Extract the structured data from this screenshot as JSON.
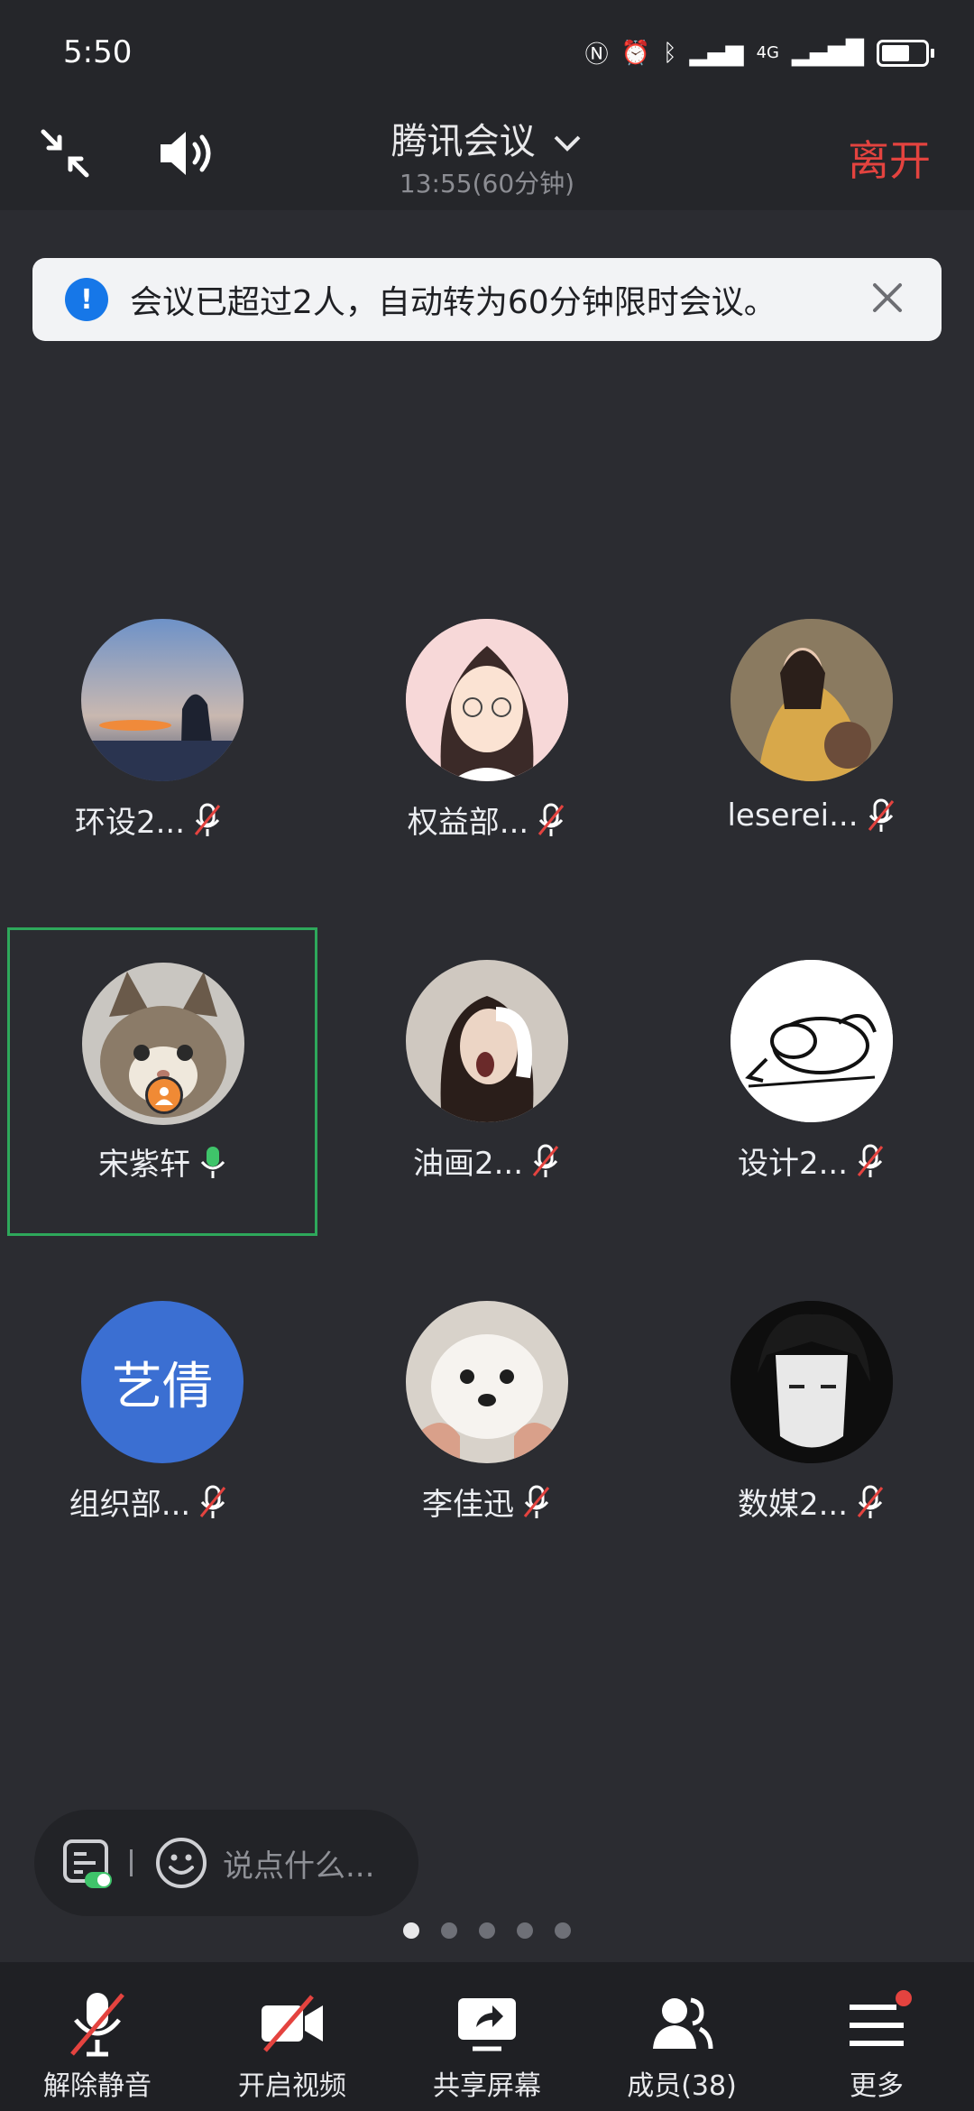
{
  "status": {
    "time": "5:50",
    "network": "4G"
  },
  "header": {
    "title": "腾讯会议",
    "subtitle": "13:55(60分钟)",
    "leave_label": "离开"
  },
  "notice": {
    "text": "会议已超过2人，自动转为60分钟限时会议。"
  },
  "participants": [
    {
      "name": "环设2...",
      "muted": true
    },
    {
      "name": "权益部...",
      "muted": true
    },
    {
      "name": "leserei...",
      "muted": true
    },
    {
      "name": "宋紫轩",
      "muted": false,
      "speaking": true,
      "host": true
    },
    {
      "name": "油画2...",
      "muted": true
    },
    {
      "name": "设计2...",
      "muted": true
    },
    {
      "name": "组织部...",
      "muted": true,
      "avatar_text": "艺倩"
    },
    {
      "name": "李佳迅",
      "muted": true
    },
    {
      "name": "数媒2...",
      "muted": true
    }
  ],
  "chat": {
    "placeholder": "说点什么..."
  },
  "pager": {
    "pages": 5,
    "current": 1
  },
  "toolbar": {
    "unmute": "解除静音",
    "video": "开启视频",
    "share": "共享屏幕",
    "members": "成员(38)",
    "more": "更多"
  },
  "colors": {
    "leave": "#e4433f",
    "speaking_border": "#2ea85b",
    "accent": "#1677e8"
  }
}
